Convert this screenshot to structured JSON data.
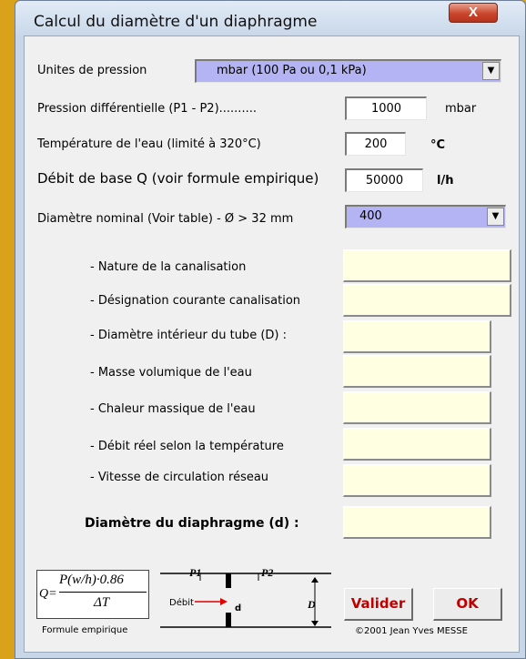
{
  "window": {
    "title": "Calcul du diamètre d'un diaphragme",
    "close_label": "X"
  },
  "fields": {
    "pressure_units": {
      "label": "Unites de pression",
      "value": "mbar  (100 Pa ou 0,1 kPa)"
    },
    "pressure_diff": {
      "label": "Pression différentielle (P1 - P2)..........",
      "value": "1000",
      "unit": "mbar"
    },
    "temperature": {
      "label": "Température de l'eau (limité à 320°C)",
      "value": "200",
      "unit": "°C"
    },
    "base_flow": {
      "label": "Débit de base Q (voir formule empirique)",
      "value": "50000",
      "unit": "l/h"
    },
    "nominal_diameter": {
      "label": "Diamètre nominal (Voir table) - Ø > 32 mm",
      "value": "400"
    }
  },
  "results": {
    "pipe_nature": {
      "label": "- Nature de la canalisation",
      "value": ""
    },
    "pipe_designation": {
      "label": "- Désignation courante canalisation",
      "value": ""
    },
    "inner_diameter": {
      "label": "- Diamètre intérieur du tube (D) :",
      "value": ""
    },
    "water_density": {
      "label": "- Masse volumique de l'eau",
      "value": ""
    },
    "specific_heat": {
      "label": "- Chaleur massique de l'eau",
      "value": ""
    },
    "real_flow": {
      "label": "- Débit réel selon la température",
      "value": ""
    },
    "flow_velocity": {
      "label": "- Vitesse de circulation réseau",
      "value": ""
    },
    "diaphragm_diameter": {
      "label": "Diamètre du diaphragme (d) :",
      "value": ""
    }
  },
  "formula": {
    "numerator": "P(w/h)·0.86",
    "lhs": "Q=",
    "denominator": "ΔT",
    "caption": "Formule empirique"
  },
  "diagram": {
    "p1": "P1",
    "p2": "P2",
    "flow_label": "Débit",
    "d_small": "d",
    "d_big": "D"
  },
  "buttons": {
    "validate": "Valider",
    "ok": "OK"
  },
  "copyright": "©2001 Jean Yves MESSE",
  "colors": {
    "accent_text": "#c00000",
    "combo_bg": "#b4b4f5",
    "result_bg": "#ffffe1"
  }
}
